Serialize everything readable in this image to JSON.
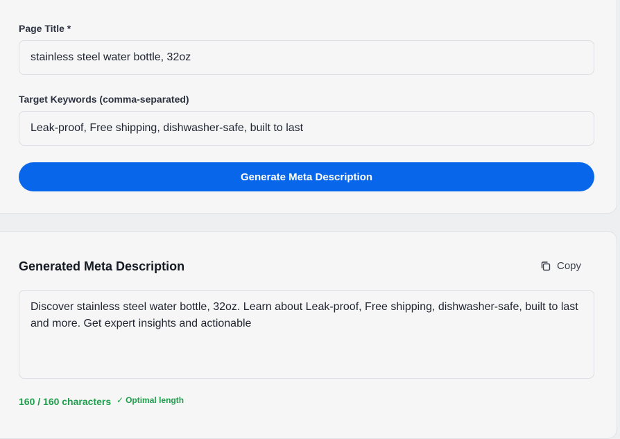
{
  "form": {
    "title_label": "Page Title *",
    "title_value": "stainless steel water bottle, 32oz",
    "keywords_label": "Target Keywords (comma-separated)",
    "keywords_value": "Leak-proof, Free shipping, dishwasher-safe, built to last",
    "generate_label": "Generate Meta Description"
  },
  "result": {
    "heading": "Generated Meta Description",
    "copy_label": "Copy",
    "copy_icon": "copy-icon",
    "description": "Discover stainless steel water bottle, 32oz. Learn about Leak-proof, Free shipping, dishwasher-safe, built to last and more. Get expert insights and actionable",
    "char_count": "160 / 160 characters",
    "status_icon": "checkmark-icon",
    "status": "Optimal length"
  },
  "colors": {
    "primary": "#0866ea",
    "success": "#1f9d4c",
    "background": "#f6f6f6"
  }
}
